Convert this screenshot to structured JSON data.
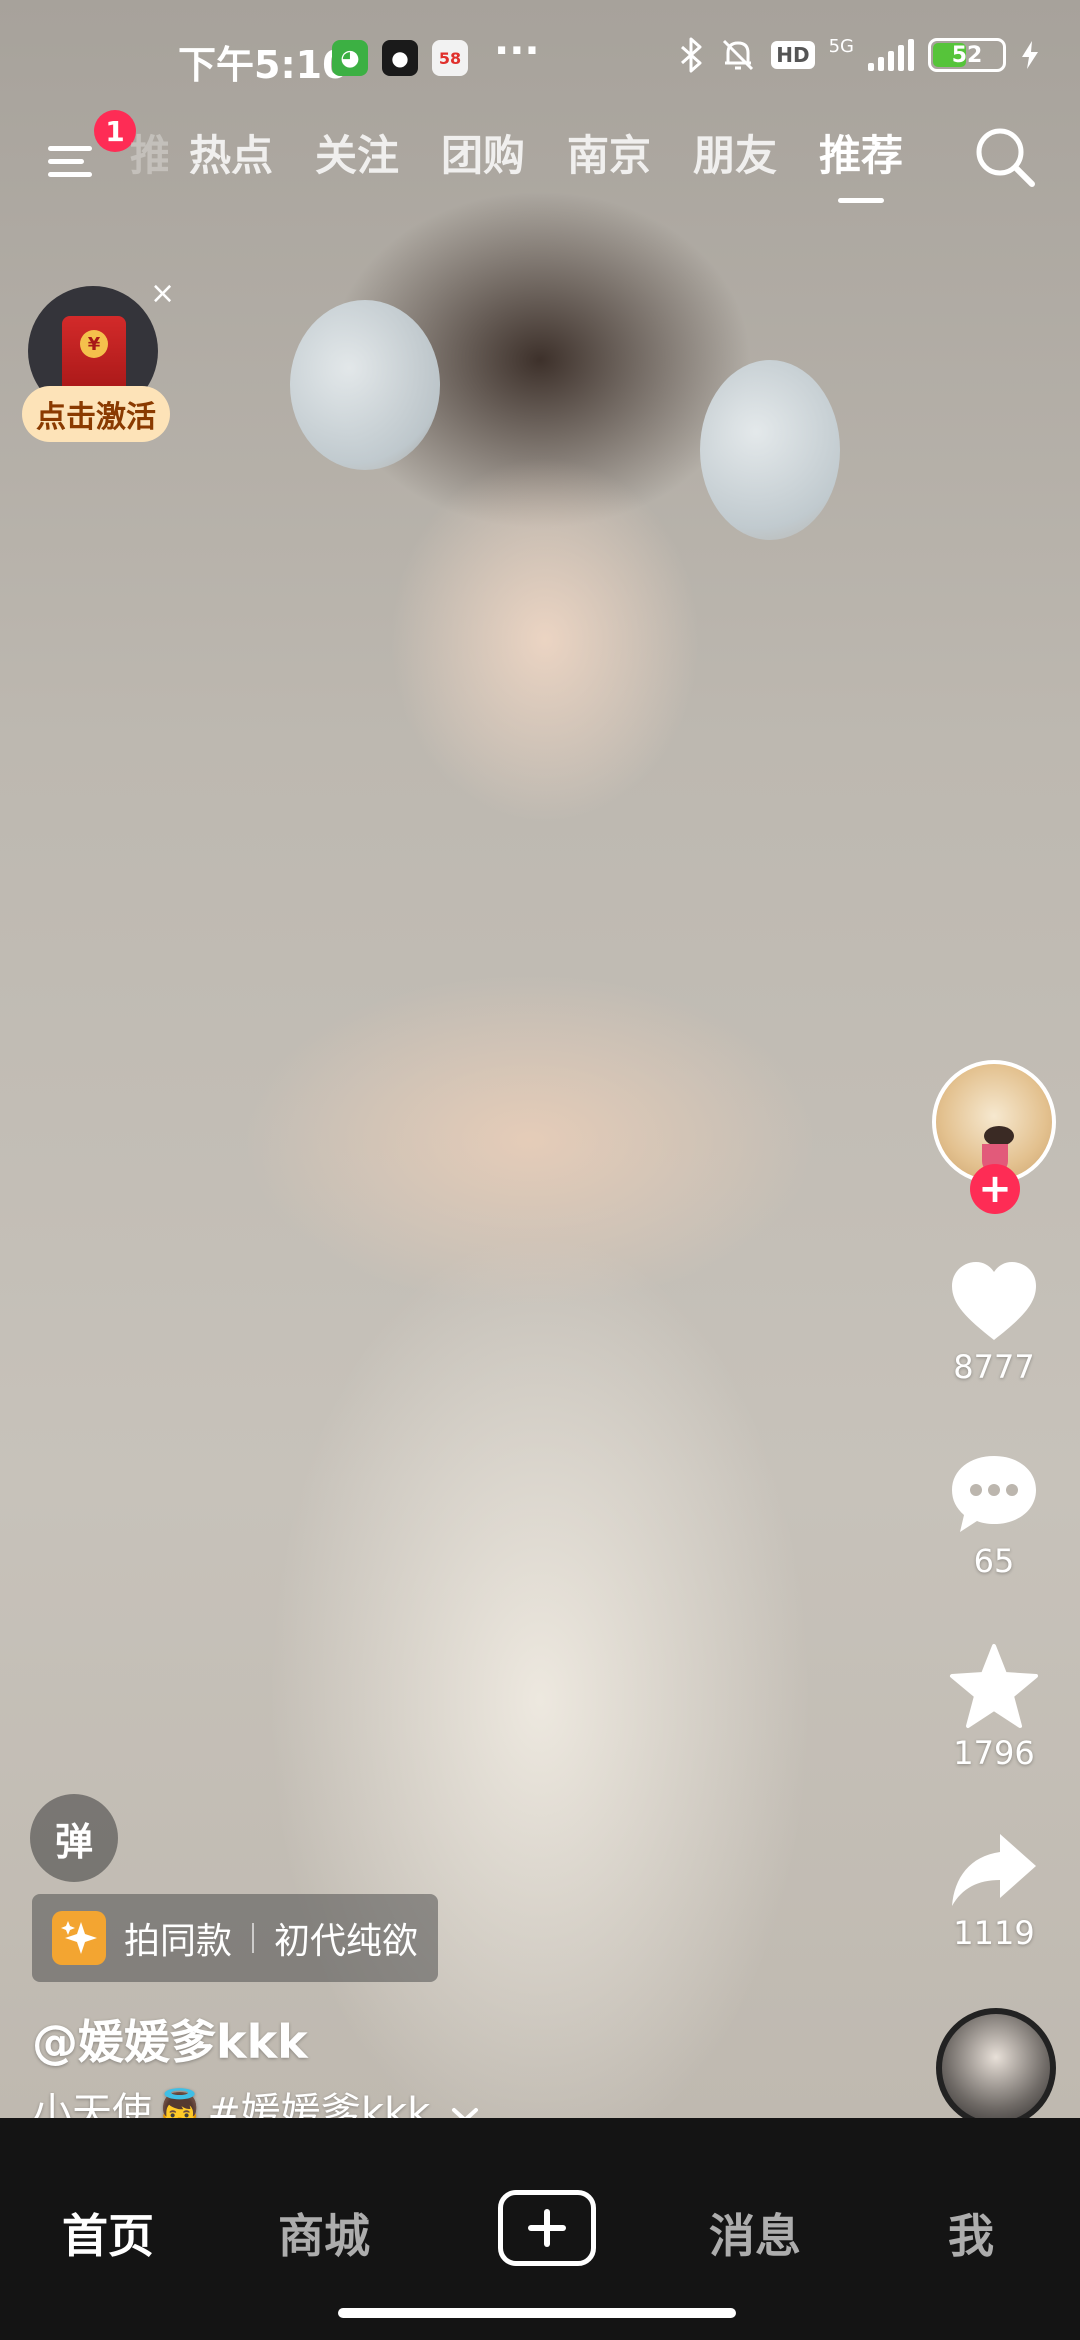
{
  "status_bar": {
    "time": "下午5:10",
    "app_icons": [
      {
        "name": "wechat-mini-icon",
        "color": "#3cb043",
        "glyph": "◕"
      },
      {
        "name": "qq-icon",
        "color": "#1a1a1a",
        "glyph": "🐧"
      },
      {
        "name": "58-app-icon",
        "color": "#f2f2f2",
        "glyph": "58"
      }
    ],
    "more": "···",
    "hd": "HD",
    "network": "5G",
    "battery_level": "52"
  },
  "top_nav": {
    "notification_count": "1",
    "partial_tab": "推",
    "tabs": [
      "热点",
      "关注",
      "团购",
      "南京",
      "朋友",
      "推荐"
    ],
    "active_tab": "推荐"
  },
  "promo": {
    "label": "点击激活",
    "close": "×"
  },
  "actions": {
    "follow": "+",
    "likes": "8777",
    "comments": "65",
    "favorites": "1796",
    "shares": "1119"
  },
  "overlay": {
    "danmu": "弹",
    "same_style": "拍同款",
    "effect_name": "初代纯欲",
    "author": "@媛媛爹kkk",
    "caption_prefix": "小天使",
    "caption_emoji": "👼",
    "caption_tag": "#媛媛爹kkk"
  },
  "tab_bar": {
    "home": "首页",
    "mall": "商城",
    "messages": "消息",
    "me": "我"
  },
  "colors": {
    "accent": "#fe2c55",
    "tab_bar_bg": "#141414",
    "battery_green": "#56c43a",
    "promo_bg": "#fde3b8"
  }
}
